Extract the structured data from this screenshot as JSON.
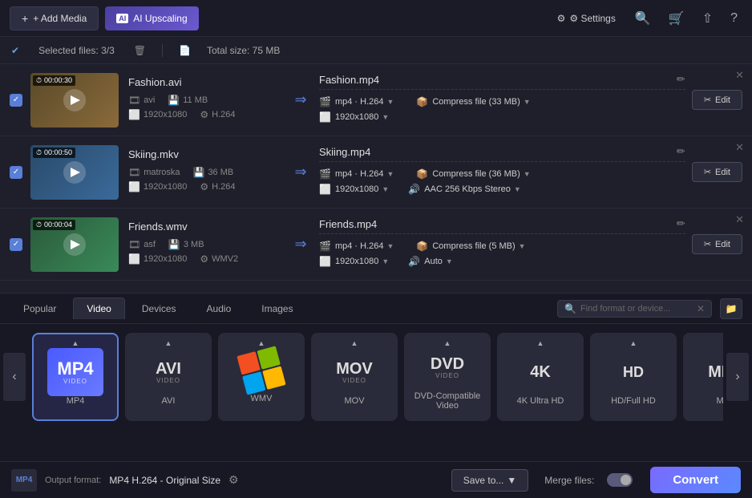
{
  "topbar": {
    "add_media_label": "+ Add Media",
    "ai_upscaling_label": "AI Upscaling",
    "settings_label": "⚙ Settings"
  },
  "statusbar": {
    "selected_files": "Selected files: 3/3",
    "total_size": "Total size: 75 MB"
  },
  "files": [
    {
      "id": "fashion",
      "name": "Fashion.avi",
      "output_name": "Fashion.mp4",
      "duration": "00:00:30",
      "format": "avi",
      "size": "11 MB",
      "resolution": "1920x1080",
      "codec": "H.264",
      "out_codec": "mp4 · H.264",
      "out_compress": "Compress file (33 MB)",
      "out_resolution": "1920x1080",
      "thumb_class": "thumb-fashion"
    },
    {
      "id": "skiing",
      "name": "Skiing.mkv",
      "output_name": "Skiing.mp4",
      "duration": "00:00:50",
      "format": "matroska",
      "size": "36 MB",
      "resolution": "1920x1080",
      "codec": "H.264",
      "out_codec": "mp4 · H.264",
      "out_compress": "Compress file (36 MB)",
      "out_resolution": "1920x1080",
      "out_audio": "AAC 256 Kbps Stereo",
      "thumb_class": "thumb-skiing"
    },
    {
      "id": "friends",
      "name": "Friends.wmv",
      "output_name": "Friends.mp4",
      "duration": "00:00:04",
      "format": "asf",
      "size": "3 MB",
      "resolution": "1920x1080",
      "codec": "WMV2",
      "out_codec": "mp4 · H.264",
      "out_compress": "Compress file (5 MB)",
      "out_resolution": "1920x1080",
      "thumb_class": "thumb-friends"
    }
  ],
  "format_panel": {
    "tabs": [
      "Popular",
      "Video",
      "Devices",
      "Audio",
      "Images"
    ],
    "active_tab": "Video",
    "search_placeholder": "Find format or device...",
    "formats": [
      {
        "id": "mp4",
        "label": "MP4",
        "sub": "VIDEO",
        "selected": true
      },
      {
        "id": "avi",
        "label": "AVI",
        "sub": "VIDEO",
        "selected": false
      },
      {
        "id": "wmv",
        "label": "WMV",
        "sub": "",
        "selected": false
      },
      {
        "id": "mov",
        "label": "MOV",
        "sub": "VIDEO",
        "selected": false
      },
      {
        "id": "dvd",
        "label": "DVD",
        "sub": "VIDEO",
        "selected": false
      },
      {
        "id": "4k",
        "label": "4K Ultra HD",
        "sub": "",
        "selected": false
      },
      {
        "id": "hd",
        "label": "HD/Full HD",
        "sub": "",
        "selected": false
      },
      {
        "id": "mpg",
        "label": "MPG",
        "sub": "",
        "selected": false
      }
    ]
  },
  "bottom": {
    "output_label": "Output format:",
    "output_value": "MP4 H.264 - Original Size",
    "save_label": "Save to...",
    "merge_label": "Merge files:",
    "convert_label": "Convert"
  }
}
